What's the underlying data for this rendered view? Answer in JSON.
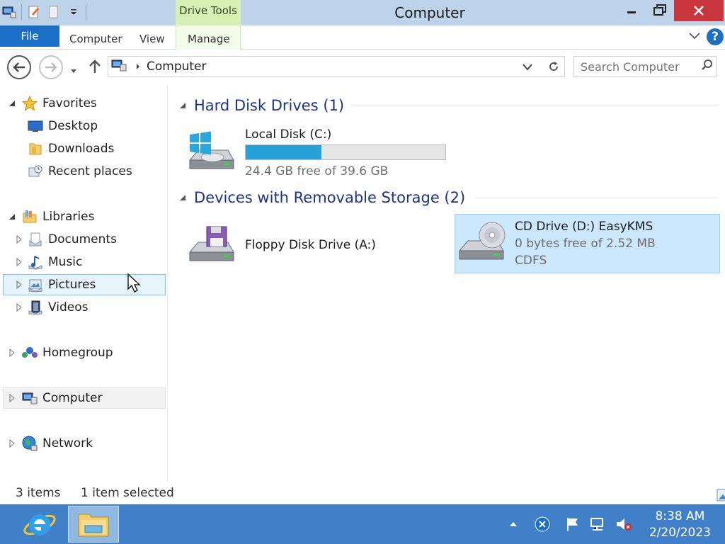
{
  "window": {
    "title": "Computer",
    "contextual_tab": "Drive Tools"
  },
  "ribbon": {
    "file": "File",
    "tabs": [
      "Computer",
      "View",
      "Manage"
    ],
    "help": "?"
  },
  "address": {
    "path": "Computer",
    "search_placeholder": "Search Computer"
  },
  "nav": {
    "favorites": {
      "label": "Favorites",
      "items": [
        "Desktop",
        "Downloads",
        "Recent places"
      ]
    },
    "libraries": {
      "label": "Libraries",
      "items": [
        "Documents",
        "Music",
        "Pictures",
        "Videos"
      ]
    },
    "homegroup": "Homegroup",
    "computer": "Computer",
    "network": "Network"
  },
  "groups": [
    {
      "title": "Hard Disk Drives (1)"
    },
    {
      "title": "Devices with Removable Storage (2)"
    }
  ],
  "drives": {
    "c": {
      "name": "Local Disk (C:)",
      "free": "24.4 GB free of 39.6 GB",
      "used_fraction": 0.38
    },
    "a": {
      "name": "Floppy Disk Drive (A:)"
    },
    "d": {
      "name": "CD Drive (D:) EasyKMS",
      "free": "0 bytes free of 2.52 MB",
      "fs": "CDFS"
    }
  },
  "status": {
    "items": "3 items",
    "selected": "1 item selected"
  },
  "taskbar": {
    "time": "8:38 AM",
    "date": "2/20/2023"
  },
  "colors": {
    "accent": "#1c6fc6",
    "taskbar": "#3f80c8",
    "usage_bar": "#26a0da",
    "group_heading": "#1e3287",
    "close_button": "#c7363c"
  }
}
